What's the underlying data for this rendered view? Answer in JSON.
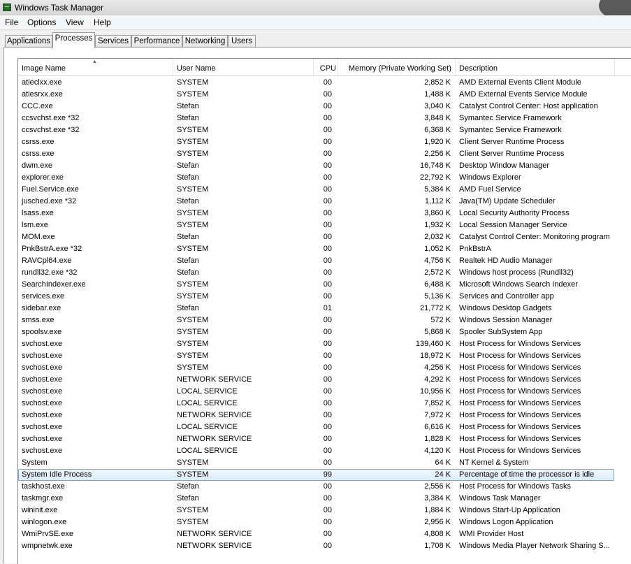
{
  "window": {
    "title": "Windows Task Manager"
  },
  "menu": [
    "File",
    "Options",
    "View",
    "Help"
  ],
  "tabs": [
    "Applications",
    "Processes",
    "Services",
    "Performance",
    "Networking",
    "Users"
  ],
  "active_tab": "Processes",
  "columns": [
    "Image Name",
    "User Name",
    "CPU",
    "Memory (Private Working Set)",
    "Description"
  ],
  "selected_row": "System Idle Process",
  "processes": [
    {
      "name": "atieclxx.exe",
      "user": "SYSTEM",
      "cpu": "00",
      "mem": "2,852 K",
      "desc": "AMD External Events Client Module"
    },
    {
      "name": "atiesrxx.exe",
      "user": "SYSTEM",
      "cpu": "00",
      "mem": "1,488 K",
      "desc": "AMD External Events Service Module"
    },
    {
      "name": "CCC.exe",
      "user": "Stefan",
      "cpu": "00",
      "mem": "3,040 K",
      "desc": "Catalyst Control Center: Host application"
    },
    {
      "name": "ccsvchst.exe *32",
      "user": "Stefan",
      "cpu": "00",
      "mem": "3,848 K",
      "desc": "Symantec Service Framework"
    },
    {
      "name": "ccsvchst.exe *32",
      "user": "SYSTEM",
      "cpu": "00",
      "mem": "6,368 K",
      "desc": "Symantec Service Framework"
    },
    {
      "name": "csrss.exe",
      "user": "SYSTEM",
      "cpu": "00",
      "mem": "1,920 K",
      "desc": "Client Server Runtime Process"
    },
    {
      "name": "csrss.exe",
      "user": "SYSTEM",
      "cpu": "00",
      "mem": "2,256 K",
      "desc": "Client Server Runtime Process"
    },
    {
      "name": "dwm.exe",
      "user": "Stefan",
      "cpu": "00",
      "mem": "16,748 K",
      "desc": "Desktop Window Manager"
    },
    {
      "name": "explorer.exe",
      "user": "Stefan",
      "cpu": "00",
      "mem": "22,792 K",
      "desc": "Windows Explorer"
    },
    {
      "name": "Fuel.Service.exe",
      "user": "SYSTEM",
      "cpu": "00",
      "mem": "5,384 K",
      "desc": "AMD Fuel Service"
    },
    {
      "name": "jusched.exe *32",
      "user": "Stefan",
      "cpu": "00",
      "mem": "1,112 K",
      "desc": "Java(TM) Update Scheduler"
    },
    {
      "name": "lsass.exe",
      "user": "SYSTEM",
      "cpu": "00",
      "mem": "3,860 K",
      "desc": "Local Security Authority Process"
    },
    {
      "name": "lsm.exe",
      "user": "SYSTEM",
      "cpu": "00",
      "mem": "1,932 K",
      "desc": "Local Session Manager Service"
    },
    {
      "name": "MOM.exe",
      "user": "Stefan",
      "cpu": "00",
      "mem": "2,032 K",
      "desc": "Catalyst Control Center: Monitoring program"
    },
    {
      "name": "PnkBstrA.exe *32",
      "user": "SYSTEM",
      "cpu": "00",
      "mem": "1,052 K",
      "desc": "PnkBstrA"
    },
    {
      "name": "RAVCpl64.exe",
      "user": "Stefan",
      "cpu": "00",
      "mem": "4,756 K",
      "desc": "Realtek HD Audio Manager"
    },
    {
      "name": "rundll32.exe *32",
      "user": "Stefan",
      "cpu": "00",
      "mem": "2,572 K",
      "desc": "Windows host process (Rundll32)"
    },
    {
      "name": "SearchIndexer.exe",
      "user": "SYSTEM",
      "cpu": "00",
      "mem": "6,488 K",
      "desc": "Microsoft Windows Search Indexer"
    },
    {
      "name": "services.exe",
      "user": "SYSTEM",
      "cpu": "00",
      "mem": "5,136 K",
      "desc": "Services and Controller app"
    },
    {
      "name": "sidebar.exe",
      "user": "Stefan",
      "cpu": "01",
      "mem": "21,772 K",
      "desc": "Windows Desktop Gadgets"
    },
    {
      "name": "smss.exe",
      "user": "SYSTEM",
      "cpu": "00",
      "mem": "572 K",
      "desc": "Windows Session Manager"
    },
    {
      "name": "spoolsv.exe",
      "user": "SYSTEM",
      "cpu": "00",
      "mem": "5,868 K",
      "desc": "Spooler SubSystem App"
    },
    {
      "name": "svchost.exe",
      "user": "SYSTEM",
      "cpu": "00",
      "mem": "139,460 K",
      "desc": "Host Process for Windows Services"
    },
    {
      "name": "svchost.exe",
      "user": "SYSTEM",
      "cpu": "00",
      "mem": "18,972 K",
      "desc": "Host Process for Windows Services"
    },
    {
      "name": "svchost.exe",
      "user": "SYSTEM",
      "cpu": "00",
      "mem": "4,256 K",
      "desc": "Host Process for Windows Services"
    },
    {
      "name": "svchost.exe",
      "user": "NETWORK SERVICE",
      "cpu": "00",
      "mem": "4,292 K",
      "desc": "Host Process for Windows Services"
    },
    {
      "name": "svchost.exe",
      "user": "LOCAL SERVICE",
      "cpu": "00",
      "mem": "10,956 K",
      "desc": "Host Process for Windows Services"
    },
    {
      "name": "svchost.exe",
      "user": "LOCAL SERVICE",
      "cpu": "00",
      "mem": "7,852 K",
      "desc": "Host Process for Windows Services"
    },
    {
      "name": "svchost.exe",
      "user": "NETWORK SERVICE",
      "cpu": "00",
      "mem": "7,972 K",
      "desc": "Host Process for Windows Services"
    },
    {
      "name": "svchost.exe",
      "user": "LOCAL SERVICE",
      "cpu": "00",
      "mem": "6,616 K",
      "desc": "Host Process for Windows Services"
    },
    {
      "name": "svchost.exe",
      "user": "NETWORK SERVICE",
      "cpu": "00",
      "mem": "1,828 K",
      "desc": "Host Process for Windows Services"
    },
    {
      "name": "svchost.exe",
      "user": "LOCAL SERVICE",
      "cpu": "00",
      "mem": "4,120 K",
      "desc": "Host Process for Windows Services"
    },
    {
      "name": "System",
      "user": "SYSTEM",
      "cpu": "00",
      "mem": "64 K",
      "desc": "NT Kernel & System"
    },
    {
      "name": "System Idle Process",
      "user": "SYSTEM",
      "cpu": "99",
      "mem": "24 K",
      "desc": "Percentage of time the processor is idle"
    },
    {
      "name": "taskhost.exe",
      "user": "Stefan",
      "cpu": "00",
      "mem": "2,556 K",
      "desc": "Host Process for Windows Tasks"
    },
    {
      "name": "taskmgr.exe",
      "user": "Stefan",
      "cpu": "00",
      "mem": "3,384 K",
      "desc": "Windows Task Manager"
    },
    {
      "name": "wininit.exe",
      "user": "SYSTEM",
      "cpu": "00",
      "mem": "1,884 K",
      "desc": "Windows Start-Up Application"
    },
    {
      "name": "winlogon.exe",
      "user": "SYSTEM",
      "cpu": "00",
      "mem": "2,956 K",
      "desc": "Windows Logon Application"
    },
    {
      "name": "WmiPrvSE.exe",
      "user": "NETWORK SERVICE",
      "cpu": "00",
      "mem": "4,808 K",
      "desc": "WMI Provider Host"
    },
    {
      "name": "wmpnetwk.exe",
      "user": "NETWORK SERVICE",
      "cpu": "00",
      "mem": "1,708 K",
      "desc": "Windows Media Player Network Sharing S..."
    }
  ]
}
